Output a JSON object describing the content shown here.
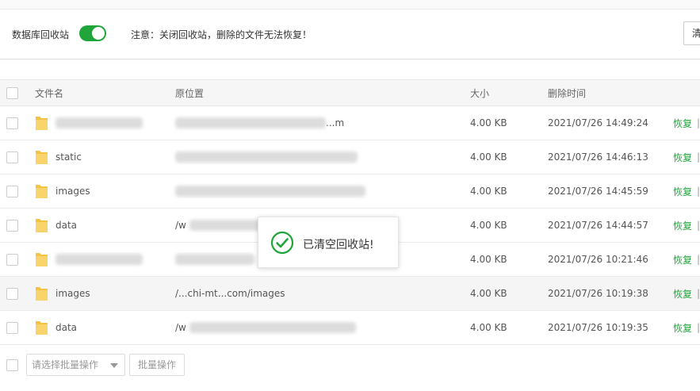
{
  "toolbar": {
    "recycle_label": "数据库回收站",
    "recycle_enabled": true,
    "notice": "注意：关闭回收站，删除的文件无法恢复！",
    "clear_button_label": "清"
  },
  "table": {
    "columns": [
      "文件名",
      "原位置",
      "大小",
      "删除时间"
    ],
    "rows": [
      {
        "name": "www.cnvte...",
        "name_blurred": true,
        "path": "...m",
        "size": "4.00 KB",
        "time": "2021/07/26 14:49:24",
        "action": "恢复",
        "highlighted": false
      },
      {
        "name": "static",
        "name_blurred": false,
        "path": "",
        "size": "4.00 KB",
        "time": "2021/07/26 14:46:13",
        "action": "恢复",
        "highlighted": false
      },
      {
        "name": "images",
        "name_blurred": false,
        "path": "",
        "size": "4.00 KB",
        "time": "2021/07/26 14:45:59",
        "action": "恢复",
        "highlighted": false
      },
      {
        "name": "data",
        "name_blurred": false,
        "path": "/w",
        "size": "4.00 KB",
        "time": "2021/07/26 14:44:57",
        "action": "恢复",
        "highlighted": false
      },
      {
        "name": "",
        "name_blurred": true,
        "path": "",
        "size": "4.00 KB",
        "time": "2021/07/26 10:21:46",
        "action": "恢复",
        "highlighted": false
      },
      {
        "name": "images",
        "name_blurred": false,
        "path": "/...chi-mt...com/images",
        "size": "4.00 KB",
        "time": "2021/07/26 10:19:38",
        "action": "恢复",
        "highlighted": true
      },
      {
        "name": "data",
        "name_blurred": false,
        "path": "/w",
        "size": "4.00 KB",
        "time": "2021/07/26 10:19:35",
        "action": "恢复",
        "highlighted": false
      }
    ],
    "action_separator": "|"
  },
  "footer": {
    "batch_placeholder": "请选择批量操作",
    "batch_button": "批量操作"
  },
  "toast": {
    "message": "已清空回收站!"
  },
  "icons": {
    "folder": "folder-icon",
    "toast": "check-circle-icon",
    "select": "chevron-down-icon"
  },
  "colors": {
    "accent": "#20a53a",
    "folder": "#f5c343"
  }
}
